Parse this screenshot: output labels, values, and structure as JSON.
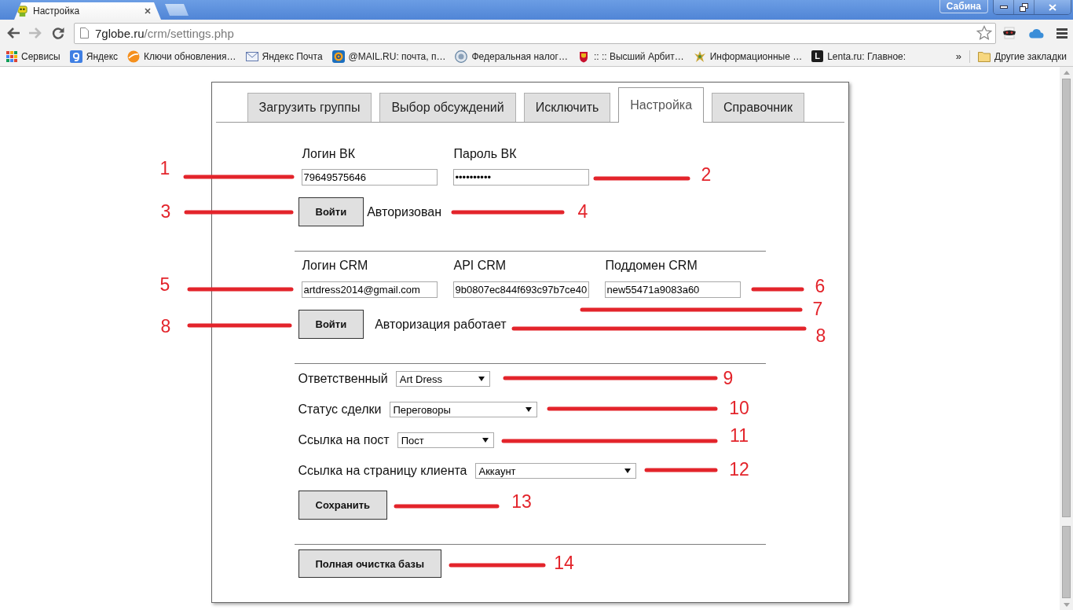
{
  "browser": {
    "tab": {
      "title": "Настройка"
    },
    "profile": "Сабина",
    "address": {
      "host": "7globe.ru",
      "path": "/crm/settings.php"
    },
    "bookmarks": [
      {
        "label": "Сервисы",
        "kind": "apps"
      },
      {
        "label": "Яндекс",
        "kind": "tile"
      },
      {
        "label": "Ключи обновления…",
        "kind": "ball"
      },
      {
        "label": "Яндекс Почта",
        "kind": "envelope"
      },
      {
        "label": "@MAIL.RU: почта, п…",
        "kind": "at"
      },
      {
        "label": "Федеральная налог…",
        "kind": "seal"
      },
      {
        "label": ":: :: Высший Арбит…",
        "kind": "crest"
      },
      {
        "label": "Информационные …",
        "kind": "emblem"
      },
      {
        "label": "Lenta.ru: Главное:",
        "kind": "letter",
        "icon_text": "L"
      }
    ],
    "overflow": "»",
    "other_bookmarks": "Другие закладки"
  },
  "page": {
    "tabs": [
      {
        "label": "Загрузить группы",
        "selected": false
      },
      {
        "label": "Выбор обсуждений",
        "selected": false
      },
      {
        "label": "Исключить",
        "selected": false
      },
      {
        "label": "Настройка",
        "selected": true
      },
      {
        "label": "Справочник",
        "selected": false
      }
    ],
    "vk": {
      "fields": [
        {
          "label": "Логин ВК",
          "value": "79649575646"
        },
        {
          "label": "Пароль ВК",
          "value": "••••••••••"
        }
      ],
      "button": "Войти",
      "status": "Авторизован"
    },
    "crm": {
      "fields": [
        {
          "label": "Логин CRM",
          "value": "artdress2014@gmail.com"
        },
        {
          "label": "API CRM",
          "value": "9b0807ec844f693c97b7ce40"
        },
        {
          "label": "Поддомен CRM",
          "value": "new55471a9083a60"
        }
      ],
      "button": "Войти",
      "status": "Авторизация работает"
    },
    "settings": [
      {
        "label": "Ответственный",
        "value": "Art Dress"
      },
      {
        "label": "Статус сделки",
        "value": "Переговоры"
      },
      {
        "label": "Ссылка на пост",
        "value": "Пост"
      },
      {
        "label": "Ссылка на страницу клиента",
        "value": "Аккаунт"
      }
    ],
    "save_button": "Сохранить",
    "clear_button": "Полная очистка базы"
  },
  "annotations": [
    {
      "label": "1"
    },
    {
      "label": "2"
    },
    {
      "label": "3"
    },
    {
      "label": "4"
    },
    {
      "label": "5"
    },
    {
      "label": "6"
    },
    {
      "label": "7"
    },
    {
      "label": "8"
    },
    {
      "label": "8"
    },
    {
      "label": "9"
    },
    {
      "label": "10"
    },
    {
      "label": "11"
    },
    {
      "label": "12"
    },
    {
      "label": "13"
    },
    {
      "label": "14"
    }
  ]
}
